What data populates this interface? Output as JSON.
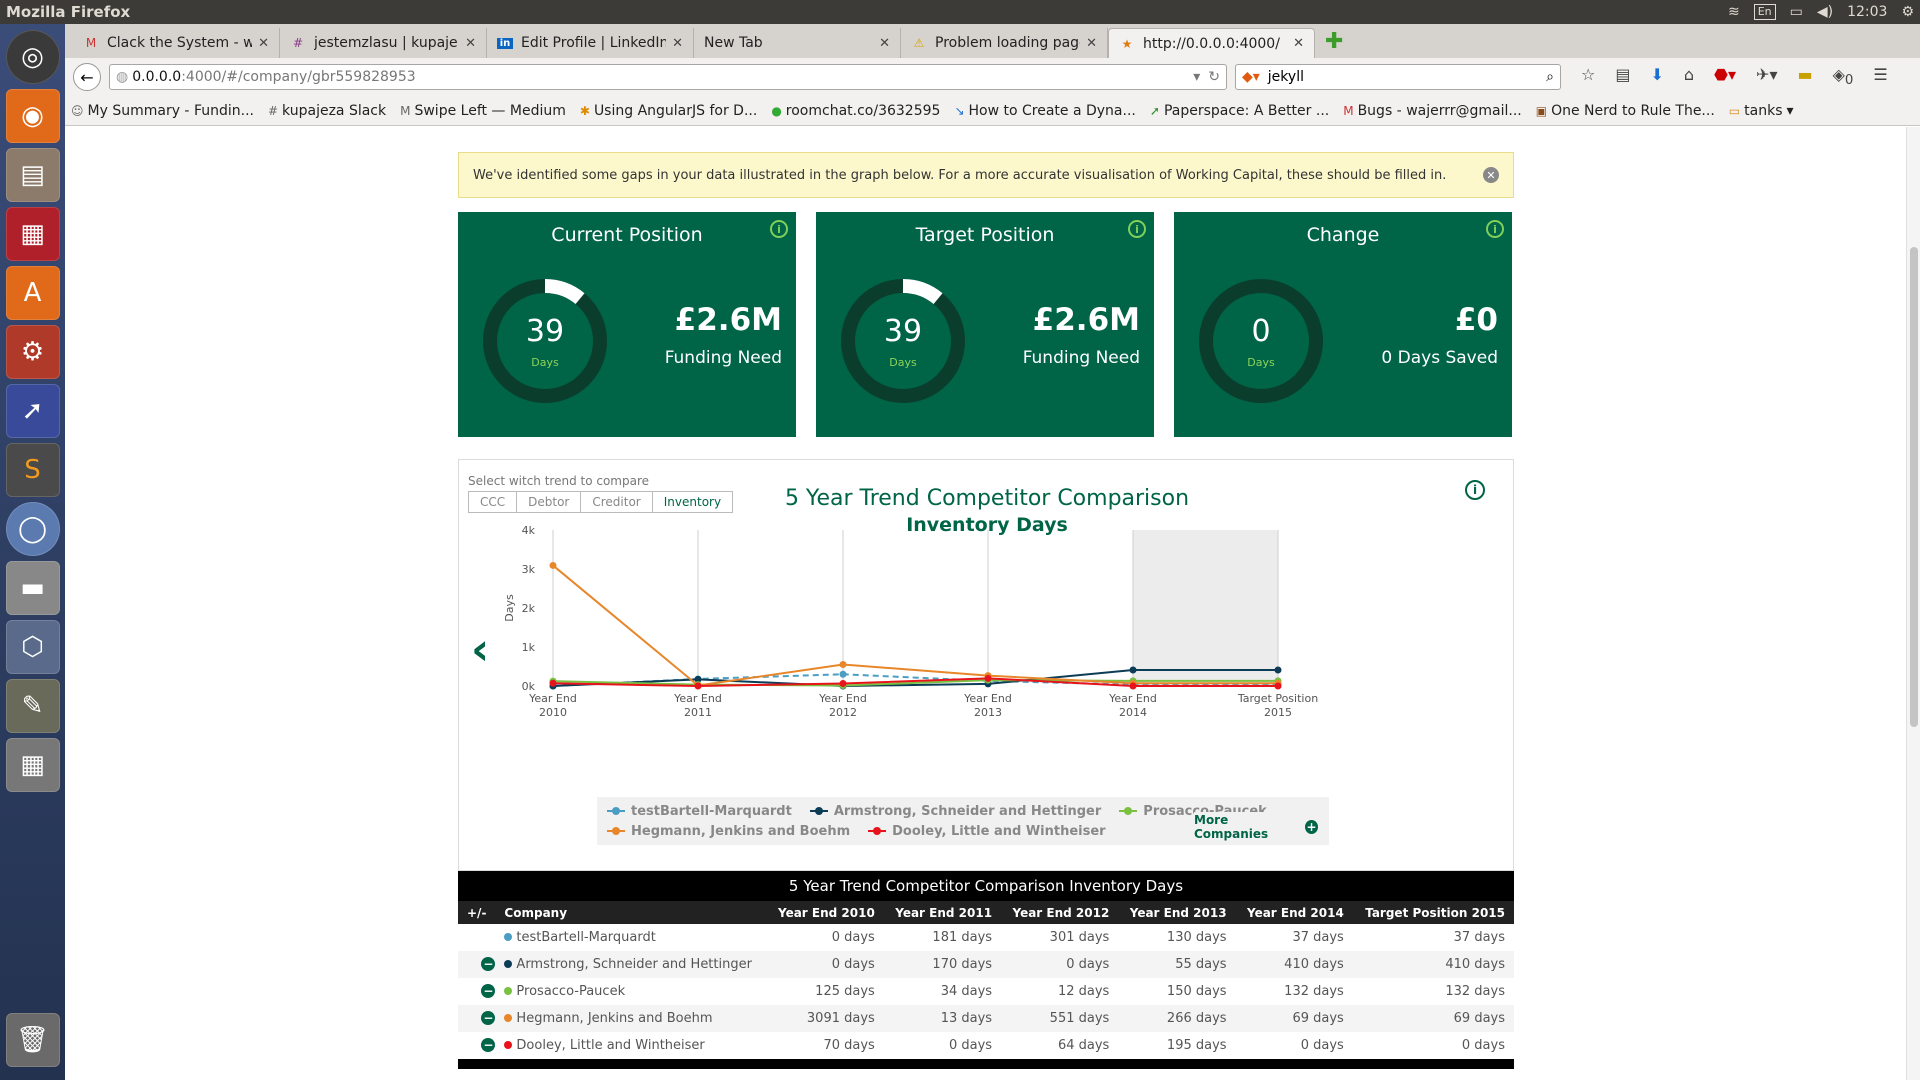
{
  "system": {
    "window_title": "Mozilla Firefox",
    "keyboard": "En",
    "clock": "12:03"
  },
  "launcher": [
    "ubuntu-dash-icon",
    "firefox-icon",
    "files-icon",
    "terminal-icon",
    "software-center-icon",
    "settings-icon",
    "screenshot-icon",
    "sublime-text-icon",
    "chromium-icon",
    "scanner-icon",
    "virtualbox-icon",
    "gimp-icon",
    "calculator-icon",
    "trash-icon"
  ],
  "browser": {
    "tabs": [
      {
        "label": "Clack the System - w...",
        "icon": "M"
      },
      {
        "label": "jestemzlasu | kupaje...",
        "icon": "#"
      },
      {
        "label": "Edit Profile | LinkedIn",
        "icon": "in"
      },
      {
        "label": "New Tab",
        "icon": ""
      },
      {
        "label": "Problem loading page",
        "icon": "⚠"
      },
      {
        "label": "http://0.0.0.0:4000/",
        "icon": "★"
      }
    ],
    "url_host": "0.0.0.0",
    "url_path": ":4000/#/company/gbr559828953",
    "search_value": "jekyll",
    "download_badge": "0",
    "bookmarks": [
      {
        "label": "My Summary - Fundin...",
        "icon": "☺"
      },
      {
        "label": "kupajeza Slack",
        "icon": "#"
      },
      {
        "label": "Swipe Left — Medium",
        "icon": "M"
      },
      {
        "label": "Using AngularJS for D...",
        "icon": "✱"
      },
      {
        "label": "roomchat.co/3632595",
        "icon": "●"
      },
      {
        "label": "How to Create a Dyna...",
        "icon": "↘"
      },
      {
        "label": "Paperspace: A Better ...",
        "icon": "➚"
      },
      {
        "label": "Bugs - wajerrr@gmail...",
        "icon": "M"
      },
      {
        "label": "One Nerd to Rule The...",
        "icon": "▣"
      },
      {
        "label": "tanks",
        "icon": "▭"
      }
    ]
  },
  "alert": {
    "text": "We've identified some gaps in your data illustrated in the graph below. For a more accurate visualisation of Working Capital, these should be filled in."
  },
  "cards": [
    {
      "title": "Current Position",
      "ring_value": "39",
      "ring_unit": "Days",
      "amount": "£2.6M",
      "sub": "Funding Need",
      "progress": 0.11
    },
    {
      "title": "Target Position",
      "ring_value": "39",
      "ring_unit": "Days",
      "amount": "£2.6M",
      "sub": "Funding Need",
      "progress": 0.11
    },
    {
      "title": "Change",
      "ring_value": "0",
      "ring_unit": "Days",
      "amount": "£0",
      "sub": "0 Days Saved",
      "progress": 0
    }
  ],
  "trend": {
    "label": "Select witch trend to compare",
    "tabs": [
      "CCC",
      "Debtor",
      "Creditor",
      "Inventory"
    ],
    "active_tab": "Inventory",
    "more_companies": "More Companies"
  },
  "chart_data": {
    "type": "line",
    "title": "5 Year Trend Competitor Comparison",
    "subtitle": "Inventory Days",
    "ylabel": "Days",
    "ylim": [
      0,
      4000
    ],
    "yticks": [
      "0k",
      "1k",
      "2k",
      "3k",
      "4k"
    ],
    "categories": [
      [
        "Year End",
        "2010"
      ],
      [
        "Year End",
        "2011"
      ],
      [
        "Year End",
        "2012"
      ],
      [
        "Year End",
        "2013"
      ],
      [
        "Year End",
        "2014"
      ],
      [
        "Target Position",
        "2015"
      ]
    ],
    "shaded_category": 4,
    "series": [
      {
        "name": "testBartell-Marquardt",
        "color": "#4a9ec4",
        "dashed": true,
        "values": [
          0,
          181,
          301,
          130,
          37,
          37
        ]
      },
      {
        "name": "Armstrong, Schneider and Hettinger",
        "color": "#0d3d56",
        "dashed": false,
        "values": [
          0,
          170,
          0,
          55,
          410,
          410
        ]
      },
      {
        "name": "Prosacco-Paucek",
        "color": "#7ac142",
        "dashed": false,
        "values": [
          125,
          34,
          12,
          150,
          132,
          132
        ]
      },
      {
        "name": "Hegmann, Jenkins and Boehm",
        "color": "#e8862a",
        "dashed": false,
        "values": [
          3091,
          13,
          551,
          266,
          69,
          69
        ]
      },
      {
        "name": "Dooley, Little and Wintheiser",
        "color": "#e8141b",
        "dashed": false,
        "values": [
          70,
          0,
          64,
          195,
          0,
          0
        ]
      }
    ]
  },
  "table": {
    "title": "5 Year Trend Competitor Comparison Inventory Days",
    "headers": [
      "+/-",
      "Company",
      "Year End 2010",
      "Year End 2011",
      "Year End 2012",
      "Year End 2013",
      "Year End 2014",
      "Target Position 2015"
    ],
    "rows": [
      {
        "toggle": false,
        "color": "#4a9ec4",
        "company": "testBartell-Marquardt",
        "cells": [
          "0 days",
          "181 days",
          "301 days",
          "130 days",
          "37 days",
          "37 days"
        ]
      },
      {
        "toggle": true,
        "color": "#0d3d56",
        "company": "Armstrong, Schneider and Hettinger",
        "cells": [
          "0 days",
          "170 days",
          "0 days",
          "55 days",
          "410 days",
          "410 days"
        ]
      },
      {
        "toggle": true,
        "color": "#7ac142",
        "company": "Prosacco-Paucek",
        "cells": [
          "125 days",
          "34 days",
          "12 days",
          "150 days",
          "132 days",
          "132 days"
        ]
      },
      {
        "toggle": true,
        "color": "#e8862a",
        "company": "Hegmann, Jenkins and Boehm",
        "cells": [
          "3091 days",
          "13 days",
          "551 days",
          "266 days",
          "69 days",
          "69 days"
        ]
      },
      {
        "toggle": true,
        "color": "#e8141b",
        "company": "Dooley, Little and Wintheiser",
        "cells": [
          "70 days",
          "0 days",
          "64 days",
          "195 days",
          "0 days",
          "0 days"
        ]
      }
    ]
  }
}
